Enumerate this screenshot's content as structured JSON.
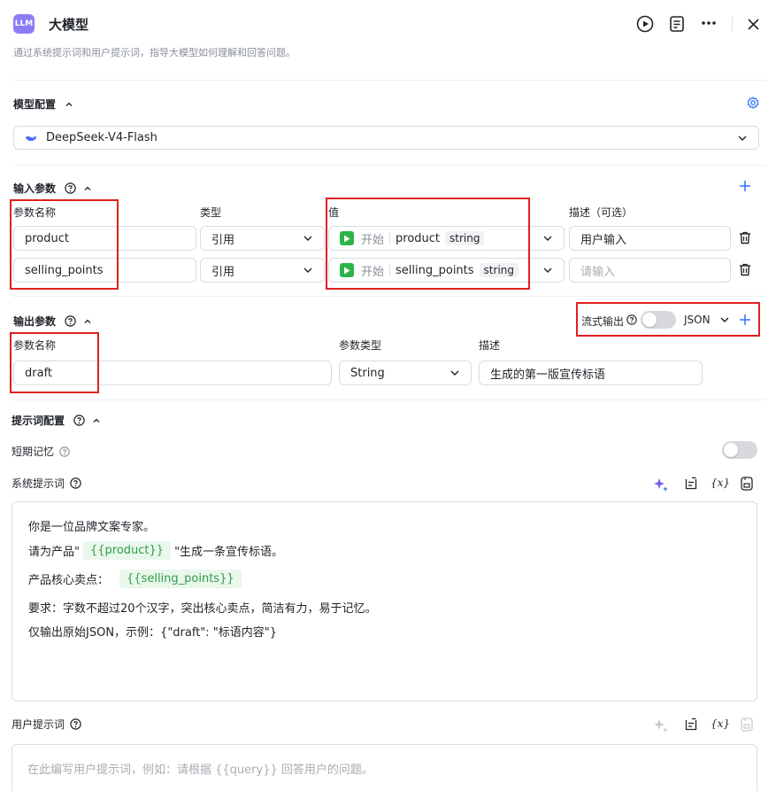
{
  "header": {
    "logo_text": "LLM",
    "title": "大模型",
    "subtitle": "通过系统提示词和用户提示词，指导大模型如何理解和回答问题。",
    "icons": [
      "play-icon",
      "document-icon",
      "more-icon",
      "close-icon"
    ]
  },
  "model_config": {
    "title": "模型配置",
    "model_name": "DeepSeek-V4-Flash"
  },
  "input_params": {
    "title": "输入参数",
    "col_name": "参数名称",
    "col_type": "类型",
    "col_value": "值",
    "col_desc": "描述（可选）",
    "rows": [
      {
        "name": "product",
        "type": "引用",
        "source": "开始",
        "var": "product",
        "vtype": "string",
        "desc": "用户输入",
        "desc_placeholder": false
      },
      {
        "name": "selling_points",
        "type": "引用",
        "source": "开始",
        "var": "selling_points",
        "vtype": "string",
        "desc": "请输入",
        "desc_placeholder": true
      }
    ]
  },
  "output_params": {
    "title": "输出参数",
    "stream_label": "流式输出",
    "format": "JSON",
    "col_name": "参数名称",
    "col_type": "参数类型",
    "col_desc": "描述",
    "row": {
      "name": "draft",
      "type": "String",
      "desc": "生成的第一版宣传标语"
    }
  },
  "prompt_config": {
    "title": "提示词配置",
    "short_memory": "短期记忆",
    "system_prompt_label": "系统提示词",
    "system_lines": {
      "l1": "你是一位品牌文案专家。",
      "l2_pre": "请为产品\"",
      "l2_var": "{{product}}",
      "l2_post": "\"生成一条宣传标语。",
      "l3_pre": "产品核心卖点：",
      "l3_var": "{{selling_points}}",
      "l4": "要求：字数不超过20个汉字，突出核心卖点，简洁有力，易于记忆。",
      "l5": "仅输出原始JSON，示例：{\"draft\": \"标语内容\"}"
    },
    "user_prompt_label": "用户提示词",
    "user_placeholder": "在此编写用户提示词，例如：请根据 {{query}} 回答用户的问题。",
    "var_button": "{x}"
  },
  "colors": {
    "accent": "#3370ff",
    "logo_bg": "#8b7cf6",
    "var_green": "#2e9e48",
    "highlight_red": "#e02020"
  }
}
